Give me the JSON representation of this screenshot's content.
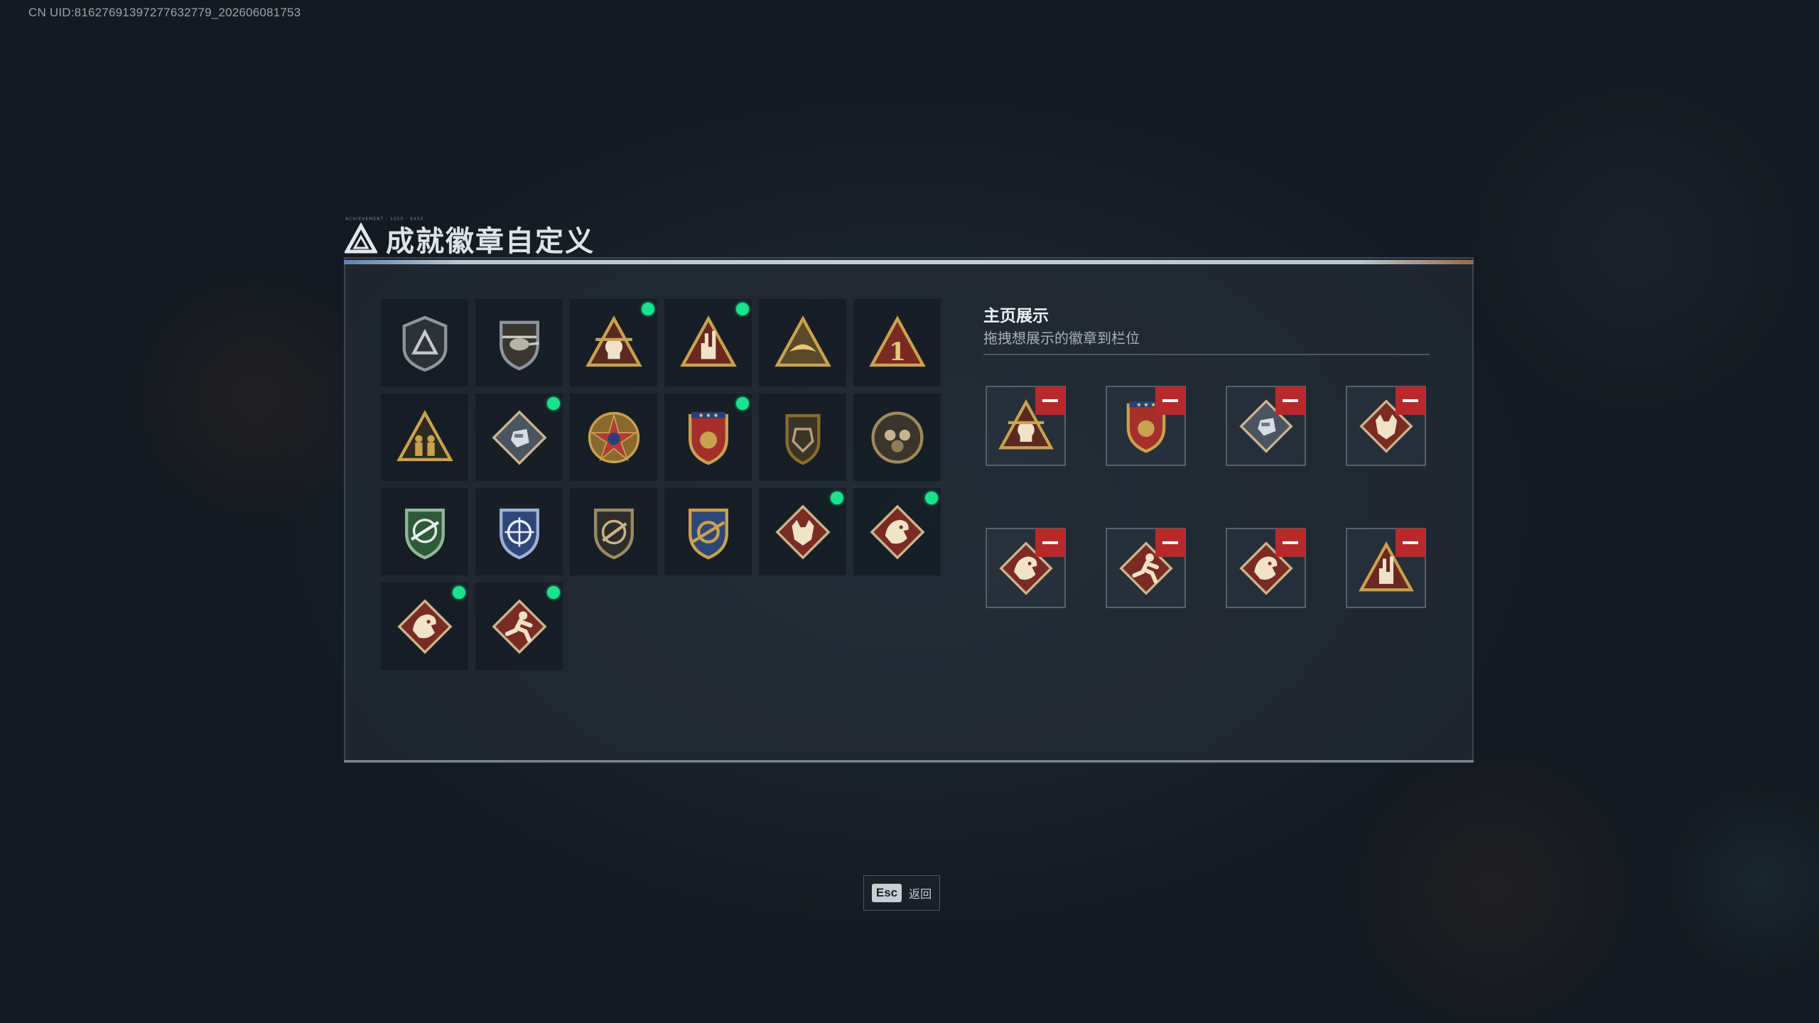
{
  "uid_text": "CN UID:8162769139727763​2779_202606081753",
  "title": {
    "text": "成就徽章自定义",
    "tiny_caption": "ACHIEVEMENT · 1050 · 9450"
  },
  "badges": [
    {
      "icon": "steel-shield-triangle-icon",
      "new": false
    },
    {
      "icon": "helicopter-shield-icon",
      "new": false
    },
    {
      "icon": "gold-skull-triangle-icon",
      "new": true
    },
    {
      "icon": "rock-hand-triangle-icon",
      "new": true
    },
    {
      "icon": "gold-bird-triangle-icon",
      "new": false
    },
    {
      "icon": "number-one-triangle-icon",
      "new": false
    },
    {
      "icon": "soldiers-triangle-icon",
      "new": false
    },
    {
      "icon": "silver-rock-diamond-icon",
      "new": true
    },
    {
      "icon": "star-compass-medal-icon",
      "new": false
    },
    {
      "icon": "star-shield-medal-icon",
      "new": true
    },
    {
      "icon": "lion-shield-badge-icon",
      "new": false
    },
    {
      "icon": "gas-mask-roundel-icon",
      "new": false
    },
    {
      "icon": "green-rifle-shield-icon",
      "new": false
    },
    {
      "icon": "blue-crosshair-shield-icon",
      "new": false
    },
    {
      "icon": "dark-rifle-shield-icon",
      "new": false
    },
    {
      "icon": "gold-crosshair-shield-icon",
      "new": false
    },
    {
      "icon": "wolf-diamond-icon",
      "new": true
    },
    {
      "icon": "dragon-diamond-icon",
      "new": true
    },
    {
      "icon": "dragon-diamond-icon",
      "new": true
    },
    {
      "icon": "runner-diamond-icon",
      "new": true
    }
  ],
  "showcase": {
    "title": "主页展示",
    "subtitle": "拖拽想展示的徽章到栏位",
    "slots": [
      {
        "icon": "gold-skull-triangle-icon"
      },
      {
        "icon": "star-shield-medal-icon"
      },
      {
        "icon": "silver-rock-diamond-icon"
      },
      {
        "icon": "wolf-diamond-icon"
      },
      {
        "icon": "dragon-diamond-icon"
      },
      {
        "icon": "runner-diamond-icon"
      },
      {
        "icon": "dragon-diamond-icon"
      },
      {
        "icon": "rock-hand-triangle-icon"
      }
    ]
  },
  "footer": {
    "esc_key": "Esc",
    "esc_label": "返回"
  },
  "colors": {
    "new_indicator": "#19e38c",
    "remove_button": "#b8292c",
    "gold": "#c9a24f",
    "crimson_diamond": "#7a2b24"
  }
}
